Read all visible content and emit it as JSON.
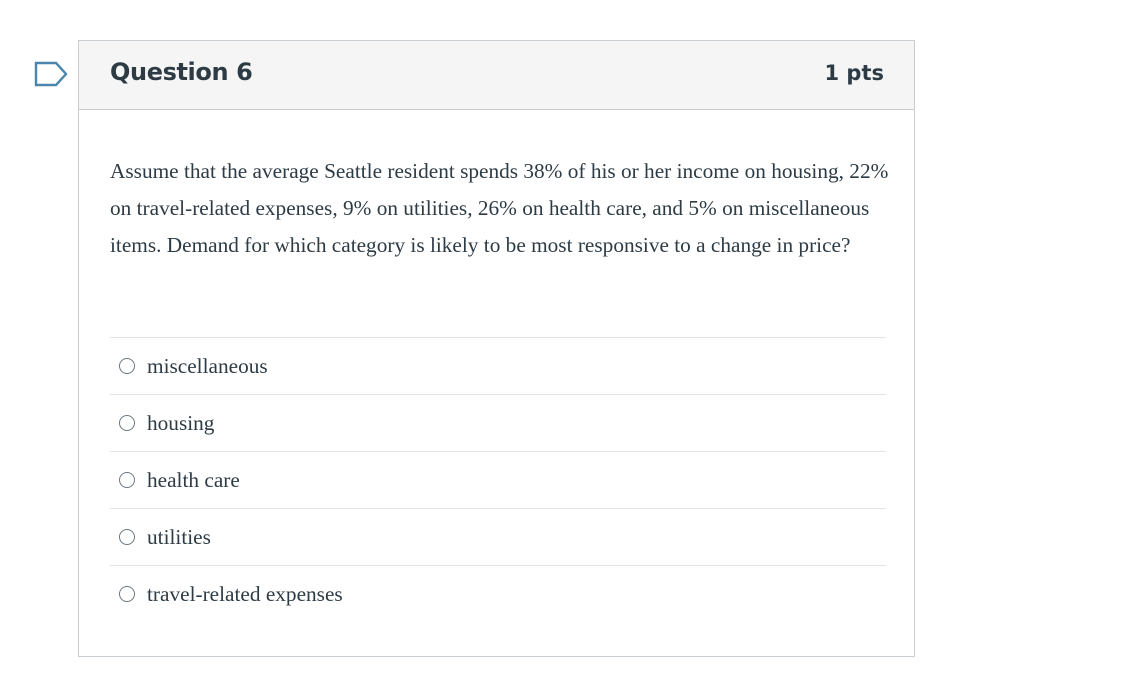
{
  "question": {
    "title": "Question 6",
    "points": "1 pts",
    "text": "Assume that the average Seattle resident spends 38% of his or her income on housing, 22% on travel-related expenses, 9% on utilities, 26% on health care, and 5% on miscellaneous items. Demand for which category is likely to be most responsive to a change in price?",
    "answers": [
      {
        "label": "miscellaneous",
        "selected": false
      },
      {
        "label": "housing",
        "selected": false
      },
      {
        "label": "health care",
        "selected": false
      },
      {
        "label": "utilities",
        "selected": false
      },
      {
        "label": "travel-related expenses",
        "selected": false
      }
    ]
  },
  "flag_icon": "bookmark-flag-icon",
  "colors": {
    "header_bg": "#f5f5f5",
    "border": "#c7cdd1",
    "text": "#2d3b45",
    "flag": "#4a86ae"
  }
}
